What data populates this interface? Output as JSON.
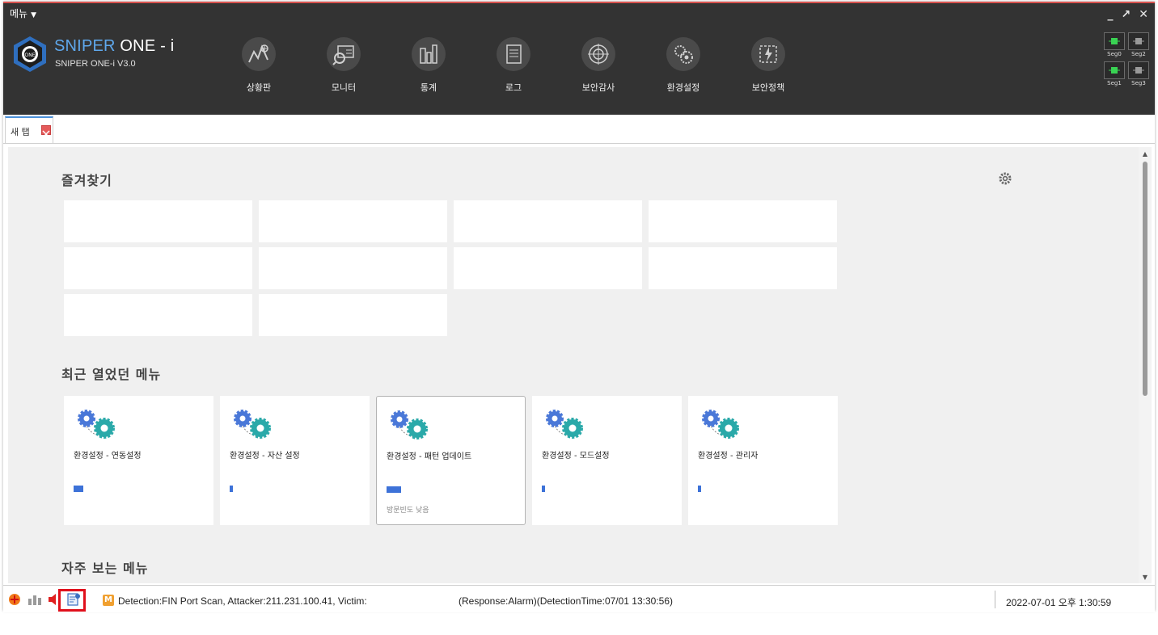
{
  "header": {
    "menu_label": "메뉴",
    "brand_prefix": "SNIPER",
    "brand_suffix": " ONE - i",
    "brand_subtitle": "SNIPER ONE-i V3.0",
    "logo_text": "ONE",
    "window_controls": {
      "minimize": "_",
      "restore": "↗",
      "close": "✕"
    },
    "nav": [
      {
        "label": "상황판",
        "icon": "dashboard-chart-icon"
      },
      {
        "label": "모니터",
        "icon": "monitor-icon"
      },
      {
        "label": "통계",
        "icon": "statistics-icon"
      },
      {
        "label": "로그",
        "icon": "log-icon"
      },
      {
        "label": "보안감사",
        "icon": "security-audit-icon"
      },
      {
        "label": "환경설정",
        "icon": "settings-gears-icon"
      },
      {
        "label": "보안정책",
        "icon": "security-policy-icon"
      }
    ],
    "segments": [
      {
        "label": "Seg0",
        "status_color": "#39d353"
      },
      {
        "label": "Seg2",
        "status_color": "#9a9a9a"
      },
      {
        "label": "Seg1",
        "status_color": "#39d353"
      },
      {
        "label": "Seg3",
        "status_color": "#9a9a9a"
      }
    ]
  },
  "tabs": [
    {
      "label": "새 탭"
    }
  ],
  "content": {
    "favorites_title": "즐겨찾기",
    "recent_title": "최근 열었던 메뉴",
    "frequent_title": "자주 보는 메뉴",
    "recent_items": [
      {
        "title": "환경설정 - 연동설정",
        "frequency": 0.12,
        "note": ""
      },
      {
        "title": "환경설정 - 자산 설정",
        "frequency": 0.04,
        "note": ""
      },
      {
        "title": "환경설정 - 패턴 업데이트",
        "frequency": 0.18,
        "note": "방문빈도 낮음"
      },
      {
        "title": "환경설정 - 모드설정",
        "frequency": 0.04,
        "note": ""
      },
      {
        "title": "환경설정 - 관리자",
        "frequency": 0.04,
        "note": ""
      }
    ]
  },
  "statusbar": {
    "alert_badge": "M",
    "alert_text": "Detection:FIN Port Scan, Attacker:211.231.100.41, Victim:",
    "alert_response": "(Response:Alarm)(DetectionTime:07/01 13:30:56)",
    "clock": "2022-07-01 오후 1:30:59"
  },
  "colors": {
    "header_bg": "#333333",
    "brand_accent": "#5fa8ec",
    "frequency_bar": "#3d72d8",
    "alert_highlight": "#e0101c"
  }
}
